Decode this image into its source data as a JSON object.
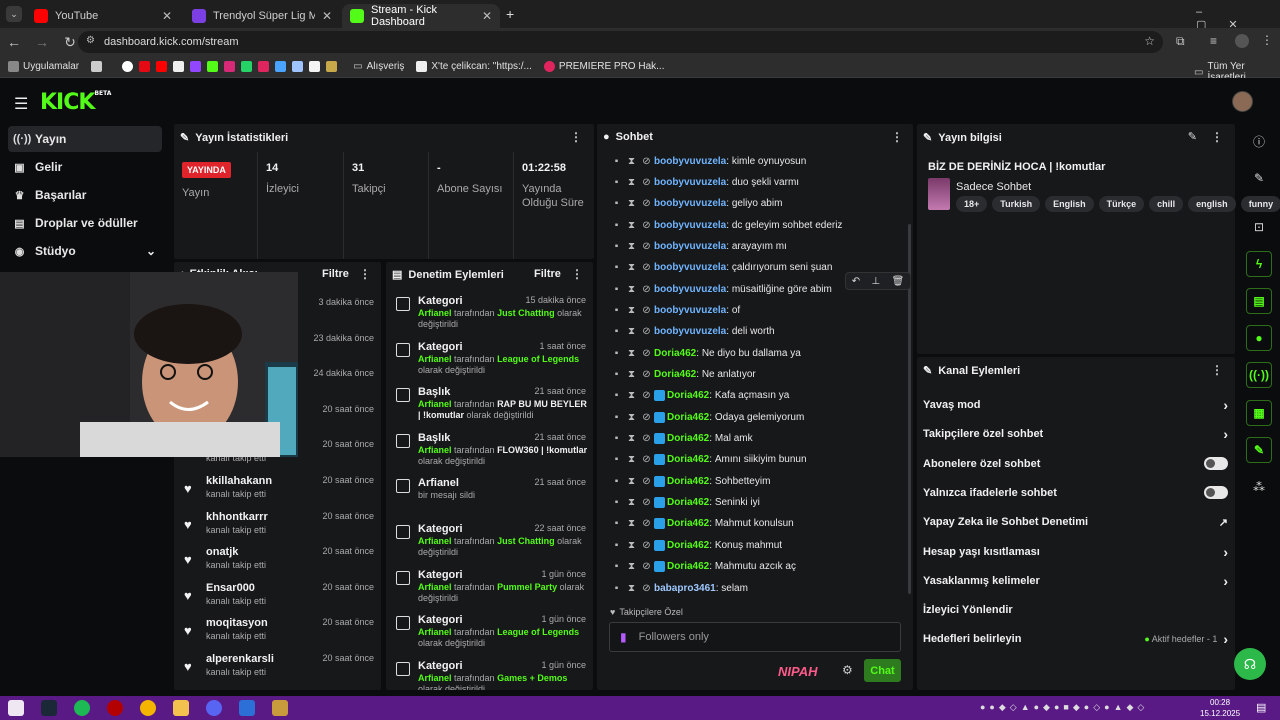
{
  "browser": {
    "tabs": [
      {
        "title": "YouTube"
      },
      {
        "title": "Trendyol Süper Lig Maç Özetler"
      },
      {
        "title": "Stream - Kick Dashboard"
      }
    ],
    "url": "dashboard.kick.com/stream",
    "bookmarks": [
      "Uygulamalar",
      "Alışveriş",
      "X'te çelikcan: \"https:/...",
      "PREMIERE PRO Hak...",
      "Tüm Yer İşaretleri"
    ]
  },
  "brand": {
    "logo": "KICK",
    "sup": "BETA"
  },
  "sidebar": {
    "items": [
      {
        "label": "Yayın",
        "icon": "broadcast-icon"
      },
      {
        "label": "Gelir",
        "icon": "wallet-icon"
      },
      {
        "label": "Başarılar",
        "icon": "trophy-icon"
      },
      {
        "label": "Droplar ve ödüller",
        "icon": "gift-icon"
      },
      {
        "label": "Stüdyo",
        "icon": "studio-icon"
      }
    ]
  },
  "stats": {
    "title": "Yayın İstatistikleri",
    "live_badge": "YAYINDA",
    "live_label": "Yayın",
    "viewers": {
      "value": "14",
      "label": "İzleyici"
    },
    "followers": {
      "value": "31",
      "label": "Takipçi"
    },
    "subs": {
      "value": "-",
      "label": "Abone Sayısı"
    },
    "uptime": {
      "value": "01:22:58",
      "label": "Yayında Olduğu Süre"
    }
  },
  "activity": {
    "title": "Etkinlik Akışı",
    "filter": "Filtre",
    "items": [
      {
        "name": "",
        "sub": "",
        "time": "3 dakika önce"
      },
      {
        "name": "",
        "sub": "",
        "time": "23 dakika önce"
      },
      {
        "name": "",
        "sub": "",
        "time": "24 dakika önce"
      },
      {
        "name": "",
        "sub": "",
        "time": "20 saat önce"
      },
      {
        "name": "",
        "sub": "kanalı takip etti",
        "time": "20 saat önce"
      },
      {
        "name": "kkillahakann",
        "sub": "kanalı takip etti",
        "time": "20 saat önce"
      },
      {
        "name": "khhontkarrr",
        "sub": "kanalı takip etti",
        "time": "20 saat önce"
      },
      {
        "name": "onatjk",
        "sub": "kanalı takip etti",
        "time": "20 saat önce"
      },
      {
        "name": "Ensar000",
        "sub": "kanalı takip etti",
        "time": "20 saat önce"
      },
      {
        "name": "moqitasyon",
        "sub": "kanalı takip etti",
        "time": "20 saat önce"
      },
      {
        "name": "alperenkarsli",
        "sub": "kanalı takip etti",
        "time": "20 saat önce"
      }
    ]
  },
  "moderation": {
    "title": "Denetim Eylemleri",
    "filter": "Filtre",
    "items": [
      {
        "title": "Kategori",
        "time": "15 dakika önce",
        "user": "Arfianel",
        "mid": " tarafından ",
        "value": "Just Chatting",
        "end": " olarak değiştirildi"
      },
      {
        "title": "Kategori",
        "time": "1 saat önce",
        "user": "Arfianel",
        "mid": " tarafından ",
        "value": "League of Legends",
        "end": " olarak değiştirildi"
      },
      {
        "title": "Başlık",
        "time": "21 saat önce",
        "user": "Arfianel",
        "mid": " tarafından ",
        "value": "RAP BU MU BEYLER | !komutlar",
        "end": " olarak değiştirildi"
      },
      {
        "title": "Başlık",
        "time": "21 saat önce",
        "user": "Arfianel",
        "mid": " tarafından ",
        "value": "FLOW360 | !komutlar",
        "end": " olarak değiştirildi"
      },
      {
        "title": "Arfianel",
        "time": "21 saat önce",
        "user": "",
        "mid": "",
        "value": "",
        "end": "bir mesajı sildi"
      },
      {
        "title": "Kategori",
        "time": "22 saat önce",
        "user": "Arfianel",
        "mid": " tarafından ",
        "value": "Just Chatting",
        "end": " olarak değiştirildi"
      },
      {
        "title": "Kategori",
        "time": "1 gün önce",
        "user": "Arfianel",
        "mid": " tarafından ",
        "value": "Pummel Party",
        "end": " olarak değiştirildi"
      },
      {
        "title": "Kategori",
        "time": "1 gün önce",
        "user": "Arfianel",
        "mid": " tarafından ",
        "value": "League of Legends",
        "end": " olarak değiştirildi"
      },
      {
        "title": "Kategori",
        "time": "1 gün önce",
        "user": "Arfianel",
        "mid": " tarafından ",
        "value": "Games + Demos",
        "end": " olarak değiştirildi"
      }
    ]
  },
  "chat": {
    "title": "Sohbet",
    "messages": [
      {
        "user": "boobyvuvuzela",
        "text": "kimle oynuyosun",
        "style": "u1",
        "badge": false
      },
      {
        "user": "boobyvuvuzela",
        "text": "duo şekli varmı",
        "style": "u1",
        "badge": false
      },
      {
        "user": "boobyvuvuzela",
        "text": "geliyo abim",
        "style": "u1",
        "badge": false
      },
      {
        "user": "boobyvuvuzela",
        "text": "dc geleyim sohbet ederiz",
        "style": "u1",
        "badge": false
      },
      {
        "user": "boobyvuvuzela",
        "text": "arayayım mı",
        "style": "u1",
        "badge": false
      },
      {
        "user": "boobyvuvuzela",
        "text": "çaldırıyorum seni şuan",
        "style": "u1",
        "badge": false
      },
      {
        "user": "boobyvuvuzela",
        "text": "müsaitliğine göre abim",
        "style": "u1",
        "badge": false
      },
      {
        "user": "boobyvuvuzela",
        "text": "of",
        "style": "u1",
        "badge": false
      },
      {
        "user": "boobyvuvuzela",
        "text": "deli worth",
        "style": "u1",
        "badge": false
      },
      {
        "user": "Doria462",
        "text": "Ne diyo bu dallama ya",
        "style": "u2",
        "badge": false
      },
      {
        "user": "Doria462",
        "text": "Ne anlatıyor",
        "style": "u2",
        "badge": false
      },
      {
        "user": "Doria462",
        "text": "Kafa açmasın ya",
        "style": "u2",
        "badge": true
      },
      {
        "user": "Doria462",
        "text": "Odaya gelemiyorum",
        "style": "u2",
        "badge": true
      },
      {
        "user": "Doria462",
        "text": "Mal amk",
        "style": "u2",
        "badge": true
      },
      {
        "user": "Doria462",
        "text": "Amını siikiyim bunun",
        "style": "u2",
        "badge": true
      },
      {
        "user": "Doria462",
        "text": "Sohbetteyim",
        "style": "u2",
        "badge": true
      },
      {
        "user": "Doria462",
        "text": "Seninki iyi",
        "style": "u2",
        "badge": true
      },
      {
        "user": "Doria462",
        "text": "Mahmut konulsun",
        "style": "u2",
        "badge": true
      },
      {
        "user": "Doria462",
        "text": "Konuş mahmut",
        "style": "u2",
        "badge": true
      },
      {
        "user": "Doria462",
        "text": "Mahmutu azcık aç",
        "style": "u2",
        "badge": true
      },
      {
        "user": "babapro3461",
        "text": "selam",
        "style": "u3",
        "badge": false
      }
    ],
    "mode_label": "Takipçilere Özel",
    "input_placeholder": "Followers only",
    "emote": "NIPAH",
    "send": "Chat"
  },
  "info": {
    "title": "Yayın bilgisi",
    "stream_title": "BİZ DE DERİNİZ HOCA | !komutlar",
    "category": "Sadece Sohbet",
    "tags": [
      "18+",
      "Turkish",
      "English",
      "Türkçe",
      "chill",
      "english",
      "funny"
    ]
  },
  "actions": {
    "title": "Kanal Eylemleri",
    "items": [
      {
        "label": "Yavaş mod",
        "kind": "chev"
      },
      {
        "label": "Takipçilere özel sohbet",
        "kind": "chev"
      },
      {
        "label": "Abonelere özel sohbet",
        "kind": "toggle"
      },
      {
        "label": "Yalnızca ifadelerle sohbet",
        "kind": "toggle"
      },
      {
        "label": "Yapay Zeka ile Sohbet Denetimi",
        "kind": "ext"
      },
      {
        "label": "Hesap yaşı kısıtlaması",
        "kind": "chev"
      },
      {
        "label": "Yasaklanmış kelimeler",
        "kind": "chev"
      },
      {
        "label": "İzleyici Yönlendir",
        "kind": "none"
      },
      {
        "label": "Hedefleri belirleyin",
        "kind": "goal"
      }
    ],
    "goal_status": "Aktif hedefler - 1"
  },
  "taskbar": {
    "time": "00:28",
    "date": "15.12.2025"
  },
  "colors": {
    "accent": "#53fc18",
    "live": "#e0242c",
    "panel": "#17181a"
  }
}
